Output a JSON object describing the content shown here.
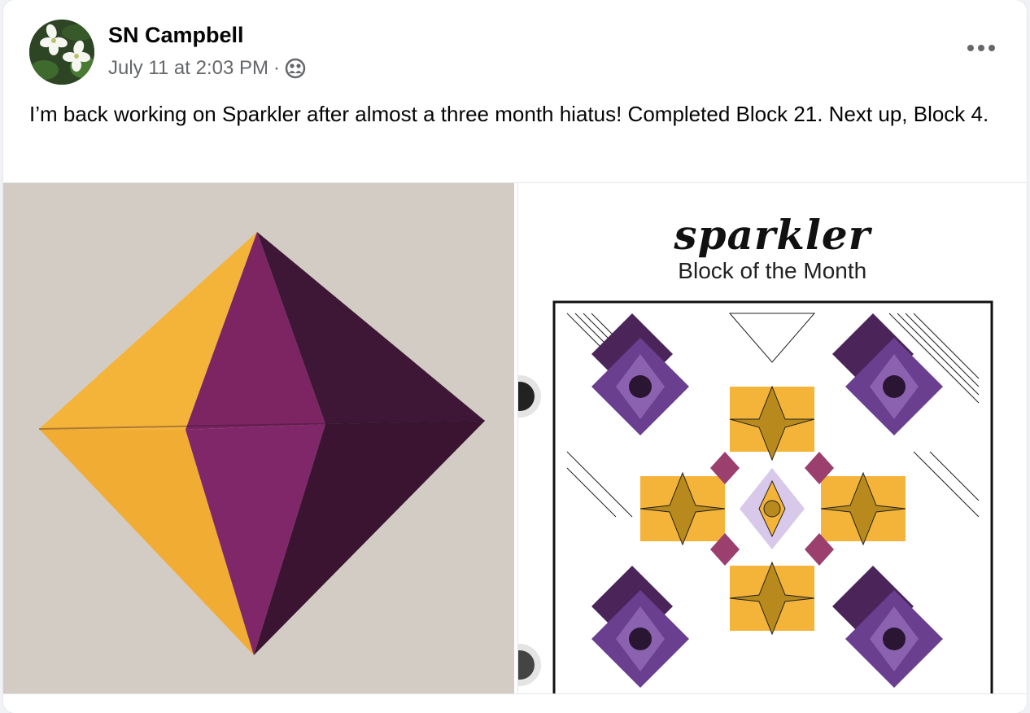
{
  "post": {
    "author": "SN Campbell",
    "timestamp": "July 11 at 2:03 PM",
    "separator": "·",
    "audience_icon": "friends-icon",
    "more_icon": "more-horizontal-icon",
    "text": "I’m back working on Sparkler after almost a three month hiatus!  Completed Block 21. Next up, Block 4."
  },
  "photos": [
    {
      "description_icon": "quilt-block-photo"
    },
    {
      "brand": "sparkler",
      "subtitle": "Block of the Month"
    }
  ],
  "colors": {
    "gold": "#f4b43a",
    "magenta": "#7d2563",
    "plum": "#3f1736",
    "purple": "#6b3f8f",
    "mustard": "#b88a1e"
  }
}
